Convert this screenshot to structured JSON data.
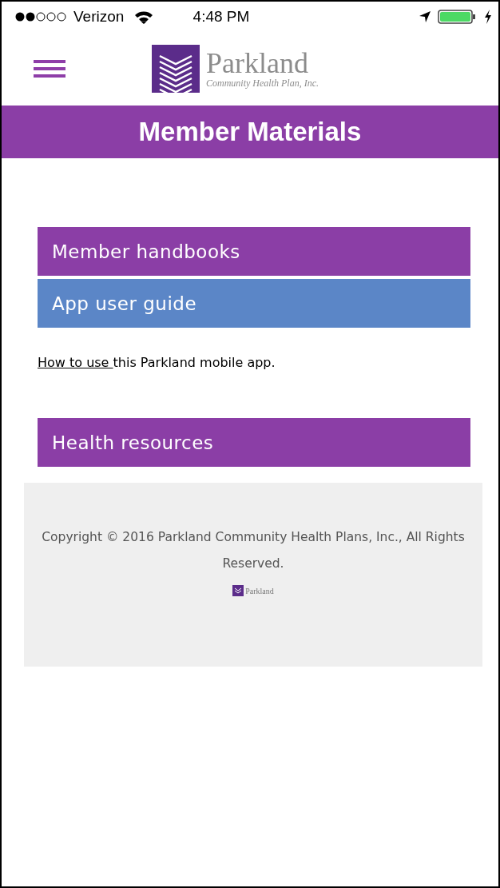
{
  "status_bar": {
    "carrier": "Verizon",
    "time": "4:48 PM"
  },
  "header": {
    "logo_name": "Parkland",
    "logo_tagline": "Community Health Plan, Inc."
  },
  "page_title": "Member Materials",
  "sections": [
    {
      "label": "Member handbooks",
      "expanded": false
    },
    {
      "label": "App user guide",
      "expanded": true,
      "content": {
        "link": "How to use ",
        "text": "this Parkland mobile app."
      }
    },
    {
      "label": "Health resources",
      "expanded": false
    }
  ],
  "footer": {
    "copyright": "Copyright © 2016 Parkland Community Health Plans, Inc., All Rights Reserved.",
    "logo_name": "Parkland"
  }
}
